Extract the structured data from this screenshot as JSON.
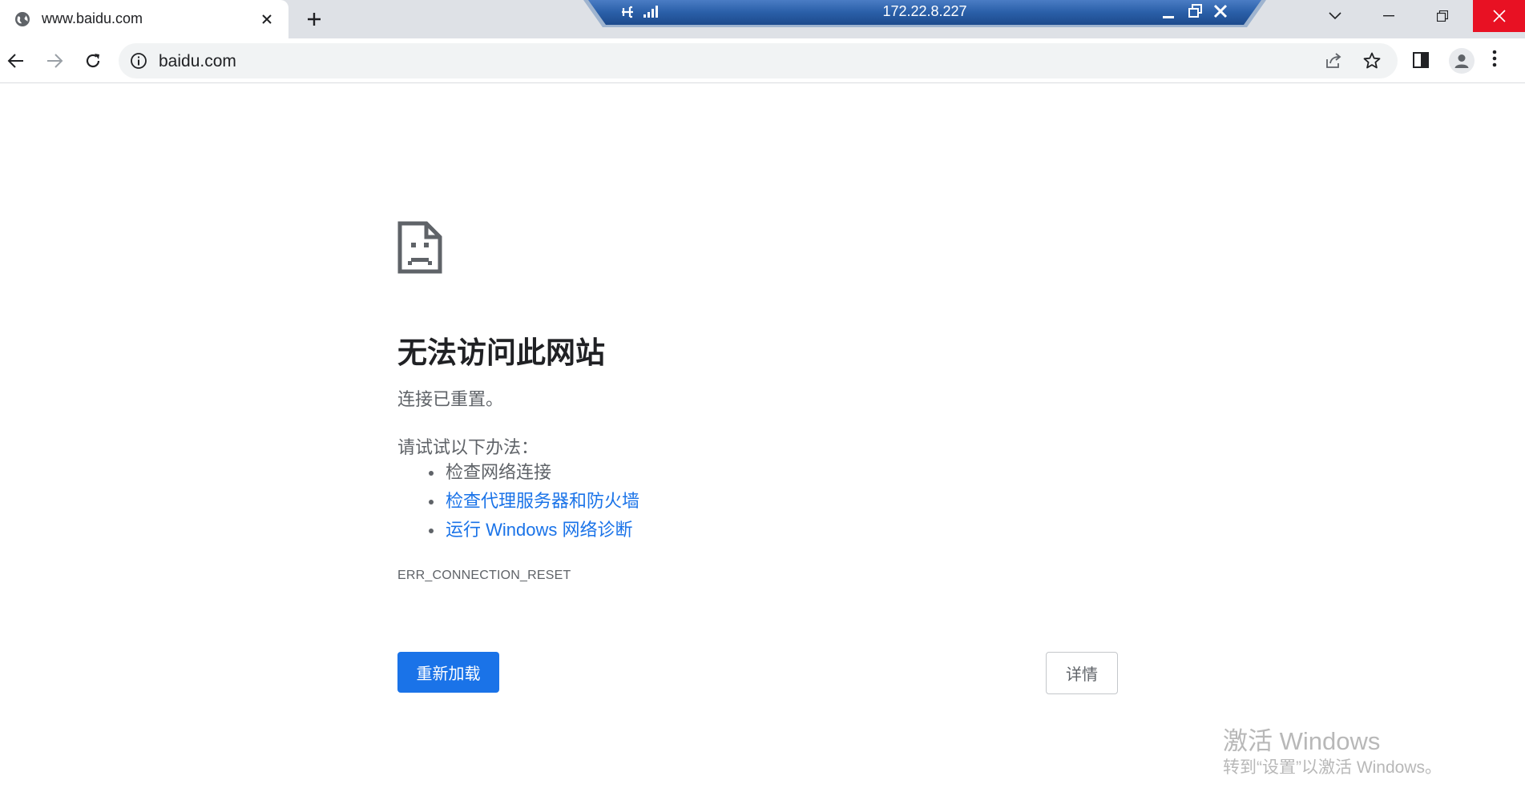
{
  "tab": {
    "title": "www.baidu.com",
    "favicon": "globe-icon"
  },
  "remote_bar": {
    "host": "172.22.8.227",
    "bg_color": "#2a5fa8"
  },
  "omnibox": {
    "url": "baidu.com",
    "security_icon": "info-icon"
  },
  "error_page": {
    "title": "无法访问此网站",
    "subtitle": "连接已重置。",
    "try_label": "请试试以下办法：",
    "suggestions": [
      {
        "text": "检查网络连接",
        "link": false
      },
      {
        "text": "检查代理服务器和防火墙",
        "link": true
      },
      {
        "text": "运行 Windows 网络诊断",
        "link": true
      }
    ],
    "error_code": "ERR_CONNECTION_RESET",
    "reload_button": "重新加载",
    "details_button": "详情",
    "icon": "sad-page-icon"
  },
  "watermark": {
    "title": "激活 Windows",
    "subtitle": "转到“设置”以激活 Windows。"
  },
  "colors": {
    "accent": "#1a73e8",
    "close_hover": "#e81123",
    "tabstrip": "#dee1e6"
  }
}
